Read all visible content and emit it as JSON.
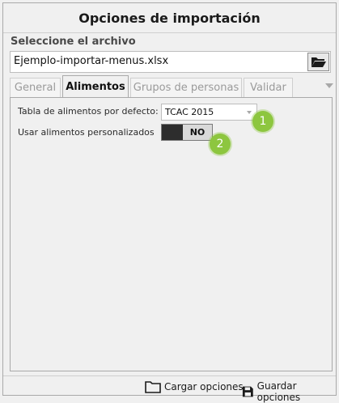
{
  "window": {
    "title": "Opciones de importación"
  },
  "file": {
    "section_label": "Seleccione el archivo",
    "name": "Ejemplo-importar-menus.xlsx",
    "browse_icon": "folder-open-icon"
  },
  "tabs": [
    {
      "label": "General",
      "active": false
    },
    {
      "label": "Alimentos",
      "active": true
    },
    {
      "label": "Grupos de personas",
      "active": false
    },
    {
      "label": "Validar",
      "active": false
    }
  ],
  "alimentos": {
    "table_label": "Tabla de alimentos por defecto:",
    "table_value": "TCAC 2015",
    "custom_label": "Usar alimentos personalizados",
    "custom_toggle": "NO",
    "badges": [
      "1",
      "2"
    ]
  },
  "footer": {
    "load_label": "Cargar opciones",
    "save_label": "Guardar opciones"
  },
  "colors": {
    "badge": "#8dc63f",
    "toggle_knob": "#2d2d2d"
  }
}
